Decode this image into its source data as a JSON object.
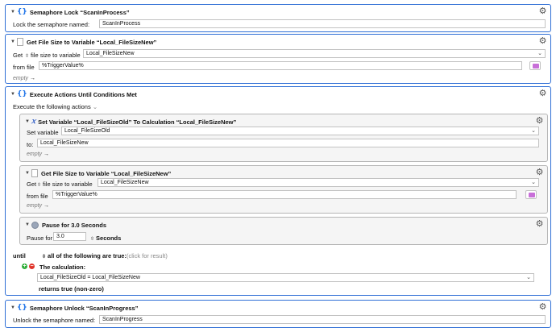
{
  "semaphore_lock": {
    "title": "Semaphore Lock “ScanInProcess”",
    "label": "Lock the semaphore named:",
    "value": "ScanInProcess"
  },
  "get_file_size_1": {
    "title": "Get File Size to Variable “Local_FileSizeNew”",
    "get_label": "Get",
    "mode": "file size to variable",
    "variable": "Local_FileSizeNew",
    "from_label": "from file",
    "file": "%TriggerValue%",
    "empty": "empty"
  },
  "execute_until": {
    "title": "Execute Actions Until Conditions Met",
    "subtitle": "Execute the following actions",
    "set_variable": {
      "title": "Set Variable “Local_FileSizeOld” To Calculation “Local_FileSizeNew”",
      "set_label": "Set variable",
      "variable": "Local_FileSizeOld",
      "to_label": "to:",
      "to_value": "Local_FileSizeNew",
      "empty": "empty"
    },
    "get_file_size_2": {
      "title": "Get File Size to Variable “Local_FileSizeNew”",
      "get_label": "Get",
      "mode": "file size to variable",
      "variable": "Local_FileSizeNew",
      "from_label": "from file",
      "file": "%TriggerValue%",
      "empty": "empty"
    },
    "pause": {
      "title": "Pause for 3.0 Seconds",
      "label": "Pause for",
      "value": "3.0",
      "unit": "Seconds"
    },
    "until": {
      "until_label": "until",
      "condition_mode": "all of the following are true:",
      "click_hint": "(click for result)",
      "calc_label": "The calculation:",
      "calc_value": "Local_FileSizeOld = Local_FileSizeNew",
      "returns_label": "returns true (non-zero)"
    }
  },
  "semaphore_unlock": {
    "title": "Semaphore Unlock “ScanInProgress”",
    "label": "Unlock the semaphore named:",
    "value": "ScanInProgress"
  },
  "icons": {
    "gear": "gear-icon",
    "braces": "braces-icon",
    "folder": "folder-icon",
    "add": "add-condition-icon",
    "remove": "remove-condition-icon"
  },
  "colors": {
    "accent_border": "#2f6fd6",
    "folder": "#c86fd8",
    "add": "#2fae3a",
    "remove": "#e0352b"
  }
}
